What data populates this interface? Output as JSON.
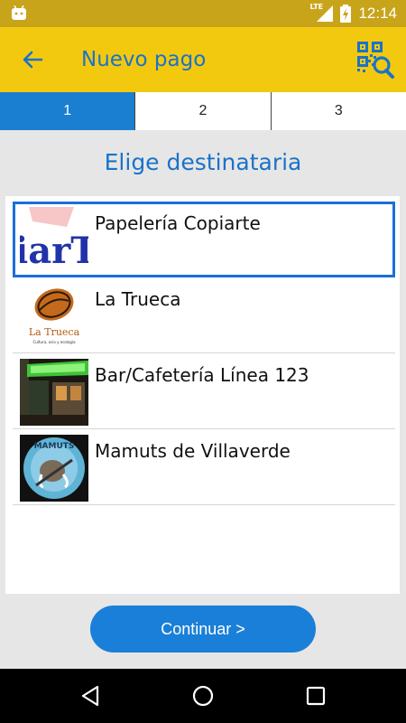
{
  "status_bar": {
    "network": "LTE",
    "time": "12:14"
  },
  "app_bar": {
    "title": "Nuevo pago",
    "back_icon": "arrow-left-icon",
    "qr_icon": "qr-search-icon"
  },
  "steps": [
    {
      "label": "1",
      "active": true
    },
    {
      "label": "2",
      "active": false
    },
    {
      "label": "3",
      "active": false
    }
  ],
  "heading": "Elige destinataria",
  "recipients": [
    {
      "name": "Papelería Copiarte",
      "selected": true,
      "logo_text": "iarT"
    },
    {
      "name": "La Trueca",
      "selected": false,
      "logo_text": "La Trueca",
      "logo_subtext": "Cultura, ocio y ecología"
    },
    {
      "name": "Bar/Cafetería Línea 123",
      "selected": false
    },
    {
      "name": "Mamuts de Villaverde",
      "selected": false,
      "logo_text": "MAMUTS"
    }
  ],
  "continue_button": "Continuar >",
  "colors": {
    "appbar": "#f3c90f",
    "statusbar": "#c8a41a",
    "accent": "#1a7fd8",
    "title_text": "#1a73c8"
  }
}
